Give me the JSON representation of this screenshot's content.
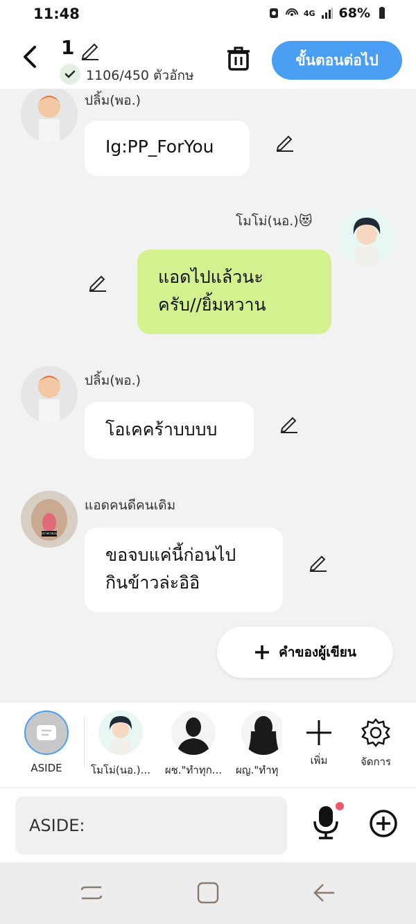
{
  "status_bar": {
    "time": "11:48",
    "network": "4G",
    "battery": "68%"
  },
  "header": {
    "episode_number": "1",
    "char_count": "1106/450 ตัวอักษ",
    "next_button": "ขั้นตอนต่อไป",
    "next_button_color": "#4a9ff5"
  },
  "messages": [
    {
      "name": "ปลิ้ม(พอ.)",
      "text": "Ig:PP_ForYou",
      "side": "left"
    },
    {
      "name": "โมโม่(นอ.)😻",
      "text_lines": [
        "แอดไปแล้วนะ",
        "ครับ//ยิ้มหวาน"
      ],
      "side": "right",
      "bubble_color": "#d4f18f"
    },
    {
      "name": "ปลิ้ม(พอ.)",
      "text": "โอเคคร้าบบบบ",
      "side": "left"
    },
    {
      "name": "แอดคนดีคนเดิม",
      "text_lines": [
        "ขอจบแค่นี้ก่อนไป",
        "กินข้าวล่ะอิอิ"
      ],
      "side": "left",
      "sticker_text": "เบาดวงแบน"
    }
  ],
  "author_note_button": "คำของผู้เขียน",
  "characters": [
    {
      "label": "ASIDE"
    },
    {
      "label": "โมโม่(นอ.)..."
    },
    {
      "label": "ผช.\"ทำทุก..."
    },
    {
      "label": "ผญ.\"ทำทุ"
    },
    {
      "label": "เพิ่ม"
    },
    {
      "label": "จัดการ"
    }
  ],
  "input": {
    "placeholder": "ASIDE:"
  }
}
